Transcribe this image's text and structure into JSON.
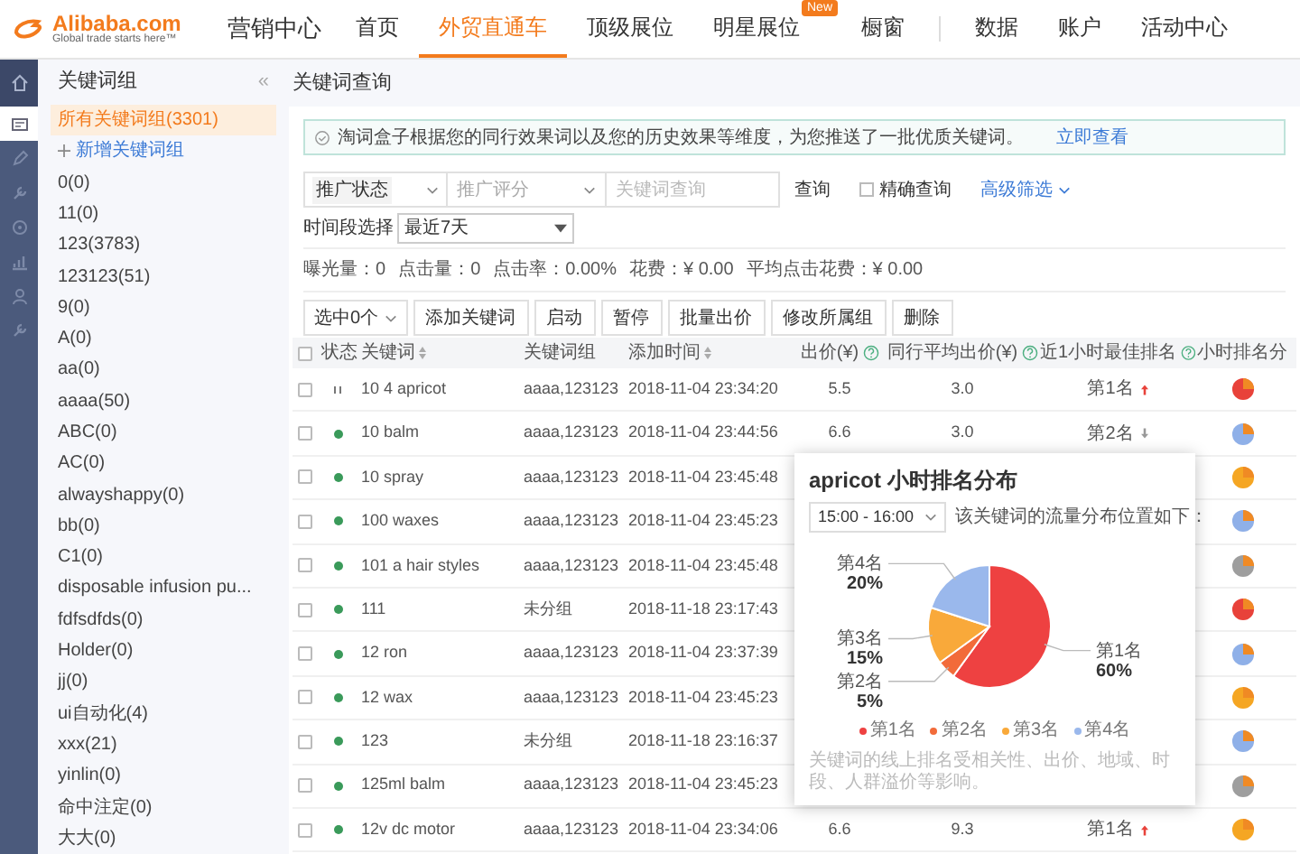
{
  "logo": {
    "name": "Alibaba.com",
    "tagline": "Global trade starts here™"
  },
  "nav": {
    "section": "营销中心",
    "items": [
      {
        "label": "首页",
        "selected": false
      },
      {
        "label": "外贸直通车",
        "selected": true
      },
      {
        "label": "顶级展位",
        "selected": false
      },
      {
        "label": "明星展位",
        "selected": false,
        "badge": "New"
      },
      {
        "label": "橱窗",
        "selected": false
      },
      {
        "label": "数据",
        "selected": false,
        "divider_before": true
      },
      {
        "label": "账户",
        "selected": false
      },
      {
        "label": "活动中心",
        "selected": false
      }
    ]
  },
  "rail": [
    {
      "selected": false
    },
    {
      "selected": true
    },
    {
      "selected": false
    },
    {
      "selected": false
    },
    {
      "selected": false
    },
    {
      "selected": false
    },
    {
      "selected": false
    },
    {
      "selected": false
    }
  ],
  "groups": {
    "title": "关键词组",
    "add": "新增关键词组",
    "items": [
      {
        "label": "所有关键词组(3301)",
        "selected": true
      },
      {
        "label": "0(0)",
        "selected": false
      },
      {
        "label": "11(0)",
        "selected": false
      },
      {
        "label": "123(3783)",
        "selected": false
      },
      {
        "label": "123123(51)",
        "selected": false
      },
      {
        "label": "9(0)",
        "selected": false
      },
      {
        "label": "A(0)",
        "selected": false
      },
      {
        "label": "aa(0)",
        "selected": false
      },
      {
        "label": "aaaa(50)",
        "selected": false
      },
      {
        "label": "ABC(0)",
        "selected": false
      },
      {
        "label": "AC(0)",
        "selected": false
      },
      {
        "label": "alwayshappy(0)",
        "selected": false
      },
      {
        "label": "bb(0)",
        "selected": false
      },
      {
        "label": "C1(0)",
        "selected": false
      },
      {
        "label": "disposable infusion pu...",
        "selected": false
      },
      {
        "label": "fdfsdfds(0)",
        "selected": false
      },
      {
        "label": "Holder(0)",
        "selected": false
      },
      {
        "label": "jj(0)",
        "selected": false
      },
      {
        "label": "ui自动化(4)",
        "selected": false
      },
      {
        "label": "xxx(21)",
        "selected": false
      },
      {
        "label": "yinlin(0)",
        "selected": false
      },
      {
        "label": "命中注定(0)",
        "selected": false
      },
      {
        "label": "大大(0)",
        "selected": false
      }
    ]
  },
  "main": {
    "collapse": "«",
    "title": "关键词查询"
  },
  "notice": {
    "text": "淘词盒子根据您的同行效果词以及您的历史效果等维度，为您推送了一批优质关键词。",
    "link": "立即查看"
  },
  "filters": {
    "status_label": "推广状态",
    "score": {
      "placeholder": "推广评分"
    },
    "search": {
      "placeholder": "关键词查询"
    },
    "query_button": "查询",
    "exact": {
      "label": "精确查询",
      "checked": false
    },
    "advanced": "高级筛选"
  },
  "time": {
    "label": "时间段选择",
    "value": "最近7天"
  },
  "stats": [
    "曝光量：0",
    "点击量：0",
    "点击率：0.00%",
    "花费：¥ 0.00",
    "平均点击花费：¥ 0.00"
  ],
  "toolbar": {
    "select": "选中0个",
    "buttons": [
      "添加关键词",
      "启动",
      "暂停",
      "批量出价",
      "修改所属组",
      "删除"
    ]
  },
  "table": {
    "select_all_checked": false,
    "columns": [
      {
        "label": "状态"
      },
      {
        "label": "关键词",
        "sortable": true
      },
      {
        "label": "关键词组"
      },
      {
        "label": "添加时间",
        "sortable": true
      },
      {
        "label": "出价(¥)",
        "help": true
      },
      {
        "label": "同行平均出价(¥)",
        "help": true
      },
      {
        "label": "近1小时最佳排名",
        "help": true
      },
      {
        "label": "小时排名分"
      }
    ],
    "rows": [
      {
        "checked": false,
        "paused": true,
        "keyword": "10 4 apricot",
        "group": "aaaa,123123",
        "time": "2018-11-04 23:34:20",
        "bid": "5.5",
        "avg_bid": "3.0",
        "rank": "第1名",
        "trend_up": true,
        "color": "#e8423a"
      },
      {
        "checked": false,
        "paused": false,
        "keyword": "10 balm",
        "group": "aaaa,123123",
        "time": "2018-11-04 23:44:56",
        "bid": "6.6",
        "avg_bid": "3.0",
        "rank": "第2名",
        "trend_up": false,
        "color": "#8fb0e8"
      },
      {
        "checked": false,
        "paused": false,
        "keyword": "10 spray",
        "group": "aaaa,123123",
        "time": "2018-11-04 23:45:48",
        "color": "#f5a623"
      },
      {
        "checked": false,
        "paused": false,
        "keyword": "100 waxes",
        "group": "aaaa,123123",
        "time": "2018-11-04 23:45:23",
        "color": "#8fb0e8"
      },
      {
        "checked": false,
        "paused": false,
        "keyword": "101 a hair styles",
        "group": "aaaa,123123",
        "time": "2018-11-04 23:45:48",
        "color": "#9e9e9e"
      },
      {
        "checked": false,
        "paused": false,
        "keyword": "111",
        "group": "未分组",
        "time": "2018-11-18 23:17:43",
        "color": "#e8423a"
      },
      {
        "checked": false,
        "paused": false,
        "keyword": "12 ron",
        "group": "aaaa,123123",
        "time": "2018-11-04 23:37:39",
        "color": "#8fb0e8"
      },
      {
        "checked": false,
        "paused": false,
        "keyword": "12 wax",
        "group": "aaaa,123123",
        "time": "2018-11-04 23:45:23",
        "color": "#f5a623"
      },
      {
        "checked": false,
        "paused": false,
        "keyword": "123",
        "group": "未分组",
        "time": "2018-11-18 23:16:37",
        "color": "#8fb0e8"
      },
      {
        "checked": false,
        "paused": false,
        "keyword": "125ml balm",
        "group": "aaaa,123123",
        "time": "2018-11-04 23:45:23",
        "color": "#9e9e9e"
      },
      {
        "checked": false,
        "paused": false,
        "keyword": "12v dc motor",
        "group": "aaaa,123123",
        "time": "2018-11-04 23:34:06",
        "bid": "6.6",
        "avg_bid": "9.3",
        "rank": "第1名",
        "trend_up": true,
        "color": "#f5a623"
      }
    ]
  },
  "popup": {
    "title": "apricot 小时排名分布",
    "range": "15:00 - 16:00",
    "caption": "该关键词的流量分布位置如下：",
    "chart_data": {
      "type": "pie",
      "categories": [
        "第1名",
        "第2名",
        "第3名",
        "第4名"
      ],
      "values": [
        60,
        5,
        15,
        20
      ],
      "value_labels": [
        "60%",
        "5%",
        "15%",
        "20%"
      ]
    },
    "legend": [
      "第1名",
      "第2名",
      "第3名",
      "第4名"
    ],
    "footnote": "关键词的线上排名受相关性、出价、地域、时段、人群溢价等影响。"
  }
}
